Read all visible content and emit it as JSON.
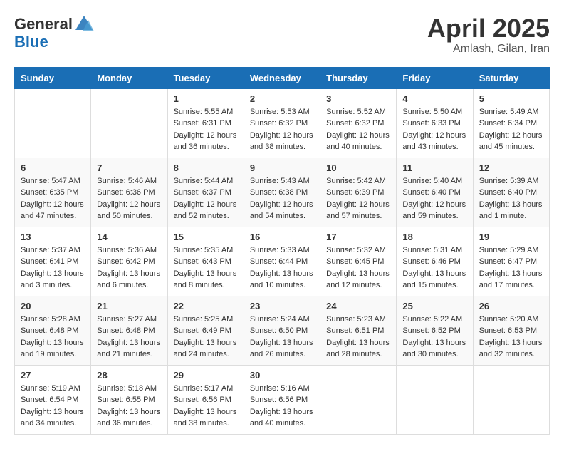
{
  "header": {
    "logo_general": "General",
    "logo_blue": "Blue",
    "month_title": "April 2025",
    "location": "Amlash, Gilan, Iran"
  },
  "calendar": {
    "days_of_week": [
      "Sunday",
      "Monday",
      "Tuesday",
      "Wednesday",
      "Thursday",
      "Friday",
      "Saturday"
    ],
    "weeks": [
      [
        {
          "day": "",
          "sunrise": "",
          "sunset": "",
          "daylight": ""
        },
        {
          "day": "",
          "sunrise": "",
          "sunset": "",
          "daylight": ""
        },
        {
          "day": "1",
          "sunrise": "Sunrise: 5:55 AM",
          "sunset": "Sunset: 6:31 PM",
          "daylight": "Daylight: 12 hours and 36 minutes."
        },
        {
          "day": "2",
          "sunrise": "Sunrise: 5:53 AM",
          "sunset": "Sunset: 6:32 PM",
          "daylight": "Daylight: 12 hours and 38 minutes."
        },
        {
          "day": "3",
          "sunrise": "Sunrise: 5:52 AM",
          "sunset": "Sunset: 6:32 PM",
          "daylight": "Daylight: 12 hours and 40 minutes."
        },
        {
          "day": "4",
          "sunrise": "Sunrise: 5:50 AM",
          "sunset": "Sunset: 6:33 PM",
          "daylight": "Daylight: 12 hours and 43 minutes."
        },
        {
          "day": "5",
          "sunrise": "Sunrise: 5:49 AM",
          "sunset": "Sunset: 6:34 PM",
          "daylight": "Daylight: 12 hours and 45 minutes."
        }
      ],
      [
        {
          "day": "6",
          "sunrise": "Sunrise: 5:47 AM",
          "sunset": "Sunset: 6:35 PM",
          "daylight": "Daylight: 12 hours and 47 minutes."
        },
        {
          "day": "7",
          "sunrise": "Sunrise: 5:46 AM",
          "sunset": "Sunset: 6:36 PM",
          "daylight": "Daylight: 12 hours and 50 minutes."
        },
        {
          "day": "8",
          "sunrise": "Sunrise: 5:44 AM",
          "sunset": "Sunset: 6:37 PM",
          "daylight": "Daylight: 12 hours and 52 minutes."
        },
        {
          "day": "9",
          "sunrise": "Sunrise: 5:43 AM",
          "sunset": "Sunset: 6:38 PM",
          "daylight": "Daylight: 12 hours and 54 minutes."
        },
        {
          "day": "10",
          "sunrise": "Sunrise: 5:42 AM",
          "sunset": "Sunset: 6:39 PM",
          "daylight": "Daylight: 12 hours and 57 minutes."
        },
        {
          "day": "11",
          "sunrise": "Sunrise: 5:40 AM",
          "sunset": "Sunset: 6:40 PM",
          "daylight": "Daylight: 12 hours and 59 minutes."
        },
        {
          "day": "12",
          "sunrise": "Sunrise: 5:39 AM",
          "sunset": "Sunset: 6:40 PM",
          "daylight": "Daylight: 13 hours and 1 minute."
        }
      ],
      [
        {
          "day": "13",
          "sunrise": "Sunrise: 5:37 AM",
          "sunset": "Sunset: 6:41 PM",
          "daylight": "Daylight: 13 hours and 3 minutes."
        },
        {
          "day": "14",
          "sunrise": "Sunrise: 5:36 AM",
          "sunset": "Sunset: 6:42 PM",
          "daylight": "Daylight: 13 hours and 6 minutes."
        },
        {
          "day": "15",
          "sunrise": "Sunrise: 5:35 AM",
          "sunset": "Sunset: 6:43 PM",
          "daylight": "Daylight: 13 hours and 8 minutes."
        },
        {
          "day": "16",
          "sunrise": "Sunrise: 5:33 AM",
          "sunset": "Sunset: 6:44 PM",
          "daylight": "Daylight: 13 hours and 10 minutes."
        },
        {
          "day": "17",
          "sunrise": "Sunrise: 5:32 AM",
          "sunset": "Sunset: 6:45 PM",
          "daylight": "Daylight: 13 hours and 12 minutes."
        },
        {
          "day": "18",
          "sunrise": "Sunrise: 5:31 AM",
          "sunset": "Sunset: 6:46 PM",
          "daylight": "Daylight: 13 hours and 15 minutes."
        },
        {
          "day": "19",
          "sunrise": "Sunrise: 5:29 AM",
          "sunset": "Sunset: 6:47 PM",
          "daylight": "Daylight: 13 hours and 17 minutes."
        }
      ],
      [
        {
          "day": "20",
          "sunrise": "Sunrise: 5:28 AM",
          "sunset": "Sunset: 6:48 PM",
          "daylight": "Daylight: 13 hours and 19 minutes."
        },
        {
          "day": "21",
          "sunrise": "Sunrise: 5:27 AM",
          "sunset": "Sunset: 6:48 PM",
          "daylight": "Daylight: 13 hours and 21 minutes."
        },
        {
          "day": "22",
          "sunrise": "Sunrise: 5:25 AM",
          "sunset": "Sunset: 6:49 PM",
          "daylight": "Daylight: 13 hours and 24 minutes."
        },
        {
          "day": "23",
          "sunrise": "Sunrise: 5:24 AM",
          "sunset": "Sunset: 6:50 PM",
          "daylight": "Daylight: 13 hours and 26 minutes."
        },
        {
          "day": "24",
          "sunrise": "Sunrise: 5:23 AM",
          "sunset": "Sunset: 6:51 PM",
          "daylight": "Daylight: 13 hours and 28 minutes."
        },
        {
          "day": "25",
          "sunrise": "Sunrise: 5:22 AM",
          "sunset": "Sunset: 6:52 PM",
          "daylight": "Daylight: 13 hours and 30 minutes."
        },
        {
          "day": "26",
          "sunrise": "Sunrise: 5:20 AM",
          "sunset": "Sunset: 6:53 PM",
          "daylight": "Daylight: 13 hours and 32 minutes."
        }
      ],
      [
        {
          "day": "27",
          "sunrise": "Sunrise: 5:19 AM",
          "sunset": "Sunset: 6:54 PM",
          "daylight": "Daylight: 13 hours and 34 minutes."
        },
        {
          "day": "28",
          "sunrise": "Sunrise: 5:18 AM",
          "sunset": "Sunset: 6:55 PM",
          "daylight": "Daylight: 13 hours and 36 minutes."
        },
        {
          "day": "29",
          "sunrise": "Sunrise: 5:17 AM",
          "sunset": "Sunset: 6:56 PM",
          "daylight": "Daylight: 13 hours and 38 minutes."
        },
        {
          "day": "30",
          "sunrise": "Sunrise: 5:16 AM",
          "sunset": "Sunset: 6:56 PM",
          "daylight": "Daylight: 13 hours and 40 minutes."
        },
        {
          "day": "",
          "sunrise": "",
          "sunset": "",
          "daylight": ""
        },
        {
          "day": "",
          "sunrise": "",
          "sunset": "",
          "daylight": ""
        },
        {
          "day": "",
          "sunrise": "",
          "sunset": "",
          "daylight": ""
        }
      ]
    ]
  }
}
